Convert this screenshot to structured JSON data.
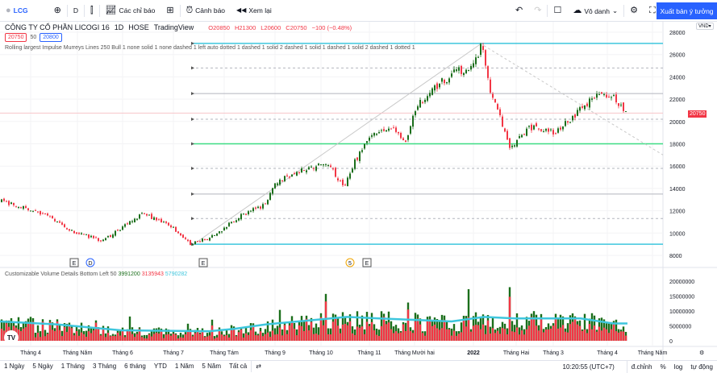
{
  "toolbar": {
    "symbol": "LCG",
    "interval": "D",
    "indicators": "Các chỉ báo",
    "alerts": "Cảnh báo",
    "replay": "Xem lại",
    "layout_name": "Vô danh",
    "publish": "Xuất bản ý tưởng"
  },
  "legend": {
    "title": "CÔNG TY CỔ PHẦN LICOGI 16",
    "interval": "1D",
    "exchange": "HOSE",
    "source": "TradingView",
    "open": "O20850",
    "high": "H21300",
    "low": "L20600",
    "close": "C20750",
    "change": "−100 (−0.48%)",
    "bid": "20750",
    "spread": "50",
    "ask": "20800"
  },
  "indicator_line": "Rolling largest Impulse Murreys Lines 250 Bull 1 none solid 1 none dashed 1 left auto dotted 1 dashed 1 solid 2 dashed 1 solid 1 dashed 1 solid 2 dashed 1 dotted 1",
  "volume_indicator": {
    "label": "Customizable Volume Details Bottom Left 50",
    "v1": "3991200",
    "v2": "3135943",
    "v3": "5790282"
  },
  "currency": "VND",
  "last_price": "20750",
  "colors": {
    "up": "#1b6e1b",
    "down": "#f23645",
    "cyan": "#3ec6dd",
    "green": "#3ddc84",
    "accent": "#2962ff"
  },
  "chart_data": {
    "type": "candlestick",
    "price_ticks": [
      "28000",
      "26000",
      "24000",
      "22000",
      "20000",
      "18000",
      "16000",
      "14000",
      "12000",
      "10000",
      "8000"
    ],
    "volume_ticks": [
      "20000000",
      "15000000",
      "10000000",
      "5000000",
      "0"
    ],
    "time_labels": [
      "Tháng 4",
      "Tháng Năm",
      "Tháng 6",
      "Tháng 7",
      "Tháng Tám",
      "Tháng 9",
      "Tháng 10",
      "Tháng 11",
      "Tháng Mười hai",
      "2022",
      "Tháng Hai",
      "Tháng 3",
      "Tháng 4",
      "Tháng Năm"
    ],
    "murrey_levels": [
      {
        "price": 27000,
        "style": "cyan"
      },
      {
        "price": 24800,
        "style": "dashed"
      },
      {
        "price": 22500,
        "style": "solid"
      },
      {
        "price": 20200,
        "style": "dashed"
      },
      {
        "price": 18000,
        "style": "green"
      },
      {
        "price": 15800,
        "style": "dashed"
      },
      {
        "price": 13500,
        "style": "solid"
      },
      {
        "price": 11300,
        "style": "dashed"
      },
      {
        "price": 9000,
        "style": "cyan"
      }
    ],
    "price_path": [
      [
        0,
        12900
      ],
      [
        27,
        12300
      ],
      [
        57,
        11600
      ],
      [
        87,
        10200
      ],
      [
        127,
        9300
      ],
      [
        177,
        11800
      ],
      [
        212,
        10600
      ],
      [
        237,
        9000
      ],
      [
        267,
        9800
      ],
      [
        297,
        11500
      ],
      [
        327,
        12500
      ],
      [
        342,
        14500
      ],
      [
        377,
        15800
      ],
      [
        407,
        16200
      ],
      [
        427,
        14000
      ],
      [
        437,
        16000
      ],
      [
        457,
        18500
      ],
      [
        487,
        19500
      ],
      [
        502,
        18000
      ],
      [
        517,
        21500
      ],
      [
        547,
        23500
      ],
      [
        567,
        24500
      ],
      [
        587,
        25000
      ],
      [
        597,
        26800
      ],
      [
        607,
        23000
      ],
      [
        617,
        21000
      ],
      [
        632,
        17500
      ],
      [
        657,
        19500
      ],
      [
        687,
        19000
      ],
      [
        712,
        20500
      ],
      [
        732,
        22000
      ],
      [
        757,
        22500
      ],
      [
        775,
        20750
      ]
    ],
    "volume_ma_path": [
      [
        0,
        6.5
      ],
      [
        70,
        5.5
      ],
      [
        150,
        3.5
      ],
      [
        260,
        3.2
      ],
      [
        290,
        4.0
      ],
      [
        330,
        5.5
      ],
      [
        390,
        7.0
      ],
      [
        430,
        8.0
      ],
      [
        470,
        7.5
      ],
      [
        560,
        6.5
      ],
      [
        600,
        8.0
      ],
      [
        640,
        7.5
      ],
      [
        720,
        7.5
      ],
      [
        760,
        5.8
      ],
      [
        778,
        5.8
      ]
    ],
    "markers": [
      "E",
      "D",
      "E",
      "5",
      "E"
    ]
  },
  "bottom": {
    "ranges": [
      "1 Ngày",
      "5 Ngày",
      "1 Tháng",
      "3 Tháng",
      "6 tháng",
      "YTD",
      "1 Năm",
      "5 Năm",
      "Tất cả"
    ],
    "clock": "10:20:55 (UTC+7)",
    "adjust": "đ.chỉnh",
    "percent": "%",
    "log": "log",
    "auto": "tự động"
  }
}
